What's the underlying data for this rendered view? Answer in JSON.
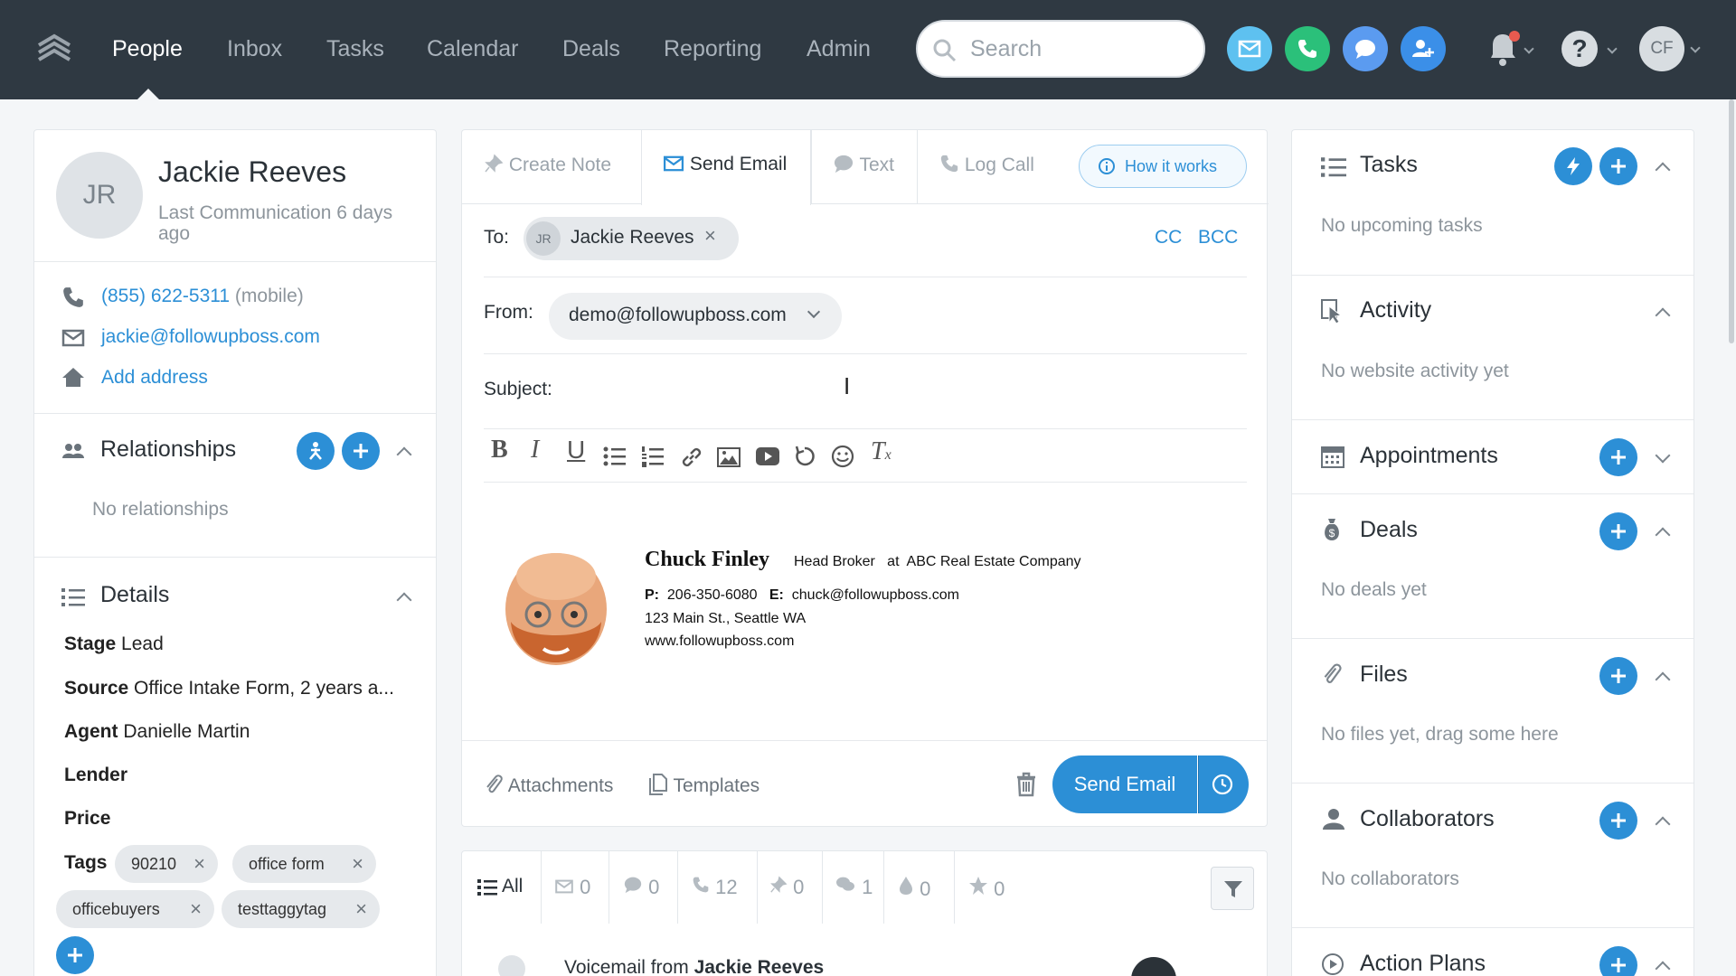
{
  "nav": {
    "items": [
      "People",
      "Inbox",
      "Tasks",
      "Calendar",
      "Deals",
      "Reporting",
      "Admin"
    ],
    "search_placeholder": "Search",
    "avatar": "CF"
  },
  "contact": {
    "initials": "JR",
    "name": "Jackie Reeves",
    "last_comm": "Last Communication 6 days",
    "last_comm2": "ago",
    "phone": "(855) 622-5311",
    "phone_type": "(mobile)",
    "email": "jackie@followupboss.com",
    "add_address": "Add address"
  },
  "relationships": {
    "title": "Relationships",
    "empty": "No relationships"
  },
  "details": {
    "title": "Details",
    "stage_label": "Stage",
    "stage": "Lead",
    "source_label": "Source",
    "source": "Office Intake Form, 2 years a...",
    "agent_label": "Agent",
    "agent": "Danielle Martin",
    "lender_label": "Lender",
    "price_label": "Price",
    "tags_label": "Tags",
    "tags": [
      "90210",
      "office form",
      "officebuyers",
      "testtaggytag"
    ]
  },
  "composer": {
    "tabs": [
      "Create Note",
      "Send Email",
      "Text",
      "Log Call"
    ],
    "how": "How it works",
    "to_label": "To:",
    "to_initials": "JR",
    "to_name": "Jackie Reeves",
    "cc": "CC",
    "bcc": "BCC",
    "from_label": "From:",
    "from_value": "demo@followupboss.com",
    "subject_label": "Subject:",
    "attachments": "Attachments",
    "templates": "Templates",
    "send": "Send Email"
  },
  "signature": {
    "name": "Chuck Finley",
    "title": "Head Broker",
    "at": "at",
    "company": "ABC Real Estate Company",
    "p_label": "P:",
    "phone": "206-350-6080",
    "e_label": "E:",
    "email": "chuck@followupboss.com",
    "address": "123 Main St., Seattle WA",
    "website": "www.followupboss.com"
  },
  "timeline": {
    "all": "All",
    "counts": [
      "0",
      "0",
      "12",
      "0",
      "1",
      "0",
      "0"
    ],
    "item_prefix": "Voicemail from",
    "item_name": "Jackie Reeves"
  },
  "right": {
    "tasks": "Tasks",
    "tasks_empty": "No upcoming tasks",
    "activity": "Activity",
    "activity_empty": "No website activity yet",
    "appointments": "Appointments",
    "deals": "Deals",
    "deals_empty": "No deals yet",
    "files": "Files",
    "files_empty": "No files yet, drag some here",
    "collaborators": "Collaborators",
    "collaborators_empty": "No collaborators",
    "action_plans": "Action Plans"
  },
  "colors": {
    "topbar": "#2f3942",
    "accent": "#2c8fd6",
    "email_btn": "#5ec1f0",
    "phone_btn": "#2bc07a",
    "chat_btn": "#5b9bf0",
    "adduser_btn": "#3b8fe8"
  }
}
